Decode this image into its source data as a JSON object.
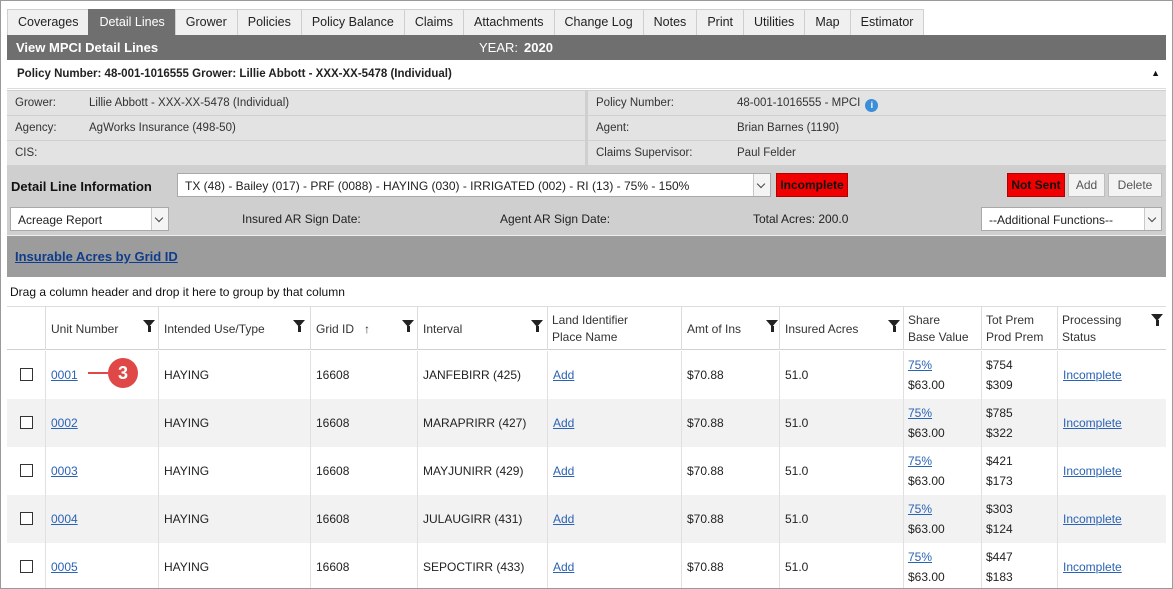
{
  "tabs": [
    {
      "label": "Coverages",
      "active": false
    },
    {
      "label": "Detail Lines",
      "active": true
    },
    {
      "label": "Grower",
      "active": false
    },
    {
      "label": "Policies",
      "active": false
    },
    {
      "label": "Policy Balance",
      "active": false
    },
    {
      "label": "Claims",
      "active": false
    },
    {
      "label": "Attachments",
      "active": false
    },
    {
      "label": "Change Log",
      "active": false
    },
    {
      "label": "Notes",
      "active": false
    },
    {
      "label": "Print",
      "active": false
    },
    {
      "label": "Utilities",
      "active": false
    },
    {
      "label": "Map",
      "active": false
    },
    {
      "label": "Estimator",
      "active": false
    }
  ],
  "title": {
    "text": "View MPCI Detail Lines",
    "year_label": "YEAR:",
    "year_value": "2020"
  },
  "policy_header": "Policy Number: 48-001-1016555 Grower: Lillie Abbott - XXX-XX-5478 (Individual)",
  "info": {
    "grower_label": "Grower:",
    "grower_value": "Lillie Abbott - XXX-XX-5478 (Individual)",
    "policy_label": "Policy Number:",
    "policy_value": "48-001-1016555 - MPCI",
    "agency_label": "Agency:",
    "agency_value": "AgWorks Insurance (498-50)",
    "agent_label": "Agent:",
    "agent_value": "Brian Barnes (1190)",
    "cis_label": "CIS:",
    "cis_value": "",
    "supervisor_label": "Claims Supervisor:",
    "supervisor_value": "Paul Felder"
  },
  "detail": {
    "label": "Detail Line Information",
    "line_select": "TX (48) - Bailey (017) - PRF (0088) - HAYING (030) - IRRIGATED (002) - RI (13) - 75% - 150%",
    "status_badge": "Incomplete",
    "sent_badge": "Not Sent",
    "add_label": "Add",
    "delete_label": "Delete",
    "report_select": "Acreage Report",
    "insured_sign_label": "Insured AR Sign Date:",
    "agent_sign_label": "Agent AR Sign Date:",
    "total_acres_label": "Total Acres: 200.0",
    "additional_functions": "--Additional Functions--"
  },
  "insurable_link": "Insurable Acres by Grid ID",
  "group_hint": "Drag a column header and drop it here to group by that column",
  "columns": {
    "unit": "Unit Number",
    "use": "Intended Use/Type",
    "grid": "Grid ID",
    "sort_arrow": "↑",
    "interval": "Interval",
    "land_1": "Land Identifier",
    "land_2": "Place Name",
    "amt": "Amt of Ins",
    "acres": "Insured Acres",
    "share_1": "Share",
    "share_2": "Base Value",
    "prem_1": "Tot Prem",
    "prem_2": "Prod Prem",
    "status_1": "Processing",
    "status_2": "Status"
  },
  "rows": [
    {
      "unit": "0001",
      "use": "HAYING",
      "grid": "16608",
      "interval": "JANFEBIRR (425)",
      "land": "Add",
      "amt": "$70.88",
      "acres": "51.0",
      "share": "75%",
      "base": "$63.00",
      "tot": "$754",
      "prod": "$309",
      "status": "Incomplete"
    },
    {
      "unit": "0002",
      "use": "HAYING",
      "grid": "16608",
      "interval": "MARAPRIRR (427)",
      "land": "Add",
      "amt": "$70.88",
      "acres": "51.0",
      "share": "75%",
      "base": "$63.00",
      "tot": "$785",
      "prod": "$322",
      "status": "Incomplete"
    },
    {
      "unit": "0003",
      "use": "HAYING",
      "grid": "16608",
      "interval": "MAYJUNIRR (429)",
      "land": "Add",
      "amt": "$70.88",
      "acres": "51.0",
      "share": "75%",
      "base": "$63.00",
      "tot": "$421",
      "prod": "$173",
      "status": "Incomplete"
    },
    {
      "unit": "0004",
      "use": "HAYING",
      "grid": "16608",
      "interval": "JULAUGIRR (431)",
      "land": "Add",
      "amt": "$70.88",
      "acres": "51.0",
      "share": "75%",
      "base": "$63.00",
      "tot": "$303",
      "prod": "$124",
      "status": "Incomplete"
    },
    {
      "unit": "0005",
      "use": "HAYING",
      "grid": "16608",
      "interval": "SEPOCTIRR (433)",
      "land": "Add",
      "amt": "$70.88",
      "acres": "51.0",
      "share": "75%",
      "base": "$63.00",
      "tot": "$447",
      "prod": "$183",
      "status": "Incomplete"
    }
  ],
  "callout": "3",
  "colors": {
    "header_gray": "#6f6f6f",
    "alert_red": "#f00000",
    "link_blue": "#2a63b5",
    "callout_red": "#e04848"
  }
}
